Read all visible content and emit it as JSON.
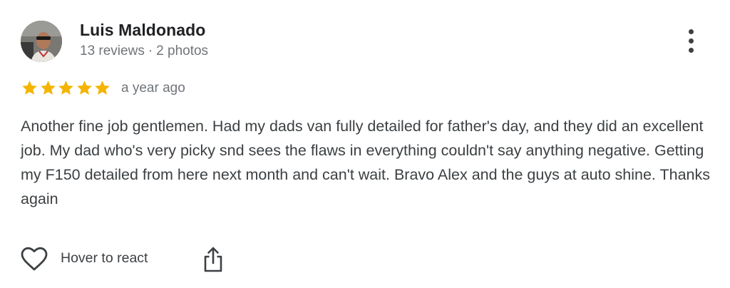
{
  "reviewer": {
    "name": "Luis Maldonado",
    "reviews": "13 reviews",
    "separator": "·",
    "photos": "2 photos"
  },
  "rating": {
    "stars": 5,
    "max": 5,
    "color": "#f4b400"
  },
  "timestamp": "a year ago",
  "review_text": "Another fine job gentlemen. Had my dads van fully detailed for father's day, and they did an excellent job. My dad who's very picky snd sees the flaws in everything couldn't say anything negative. Getting my F150 detailed from here next month and can't wait. Bravo Alex and the guys at auto shine. Thanks again",
  "actions": {
    "react_label": "Hover to react",
    "react_icon": "heart-outline-icon",
    "share_icon": "share-icon",
    "more_icon": "more-vertical-icon"
  }
}
